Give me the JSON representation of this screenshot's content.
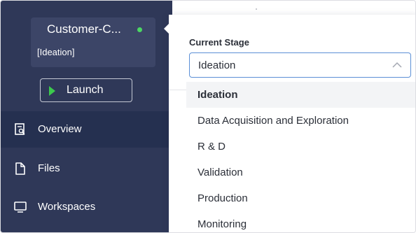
{
  "project": {
    "name": "Customer-C...",
    "stage": "[Ideation]",
    "status_color": "#4bd763"
  },
  "launch": {
    "label": "Launch",
    "icon": "play-icon"
  },
  "nav": {
    "items": [
      {
        "label": "Overview",
        "icon": "overview-icon",
        "active": true
      },
      {
        "label": "Files",
        "icon": "file-icon",
        "active": false
      },
      {
        "label": "Workspaces",
        "icon": "monitor-icon",
        "active": false
      }
    ]
  },
  "stage_select": {
    "label": "Current Stage",
    "value": "Ideation",
    "options": [
      "Ideation",
      "Data Acquisition and Exploration",
      "R & D",
      "Validation",
      "Production",
      "Monitoring"
    ],
    "selected_index": 0
  },
  "colors": {
    "sidebar_bg": "#2f3858",
    "select_border": "#5b8fd6",
    "launch_icon": "#3cc94d"
  }
}
